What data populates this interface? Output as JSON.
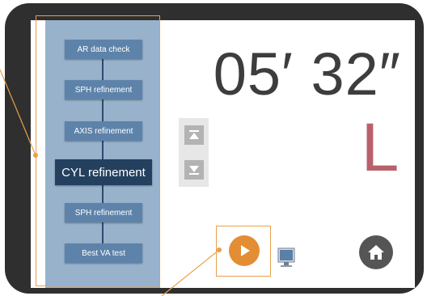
{
  "sidebar": {
    "steps": [
      {
        "label": "AR data check"
      },
      {
        "label": "SPH refinement"
      },
      {
        "label": "AXIS refinement"
      },
      {
        "label": "CYL refinement",
        "active": true
      },
      {
        "label": "SPH refinement"
      },
      {
        "label": "Best VA test"
      }
    ]
  },
  "timer": {
    "display": "05′ 32″"
  },
  "eye_indicator": {
    "label": "L"
  },
  "icons": {
    "scroll_up": "scroll-to-top-icon",
    "scroll_down": "scroll-to-bottom-icon",
    "play": "play-icon",
    "home": "home-icon",
    "screen": "monitor-icon"
  },
  "colors": {
    "device_frame": "#2f2f2f",
    "sidebar_bg": "#98b2cc",
    "step_bg": "#5e83aa",
    "step_active_bg": "#24405f",
    "timer_text": "#3d3d3d",
    "eye_text": "#b9616a",
    "play_accent": "#e38d34",
    "home_bg": "#555555",
    "annotation": "#e8a04a"
  }
}
